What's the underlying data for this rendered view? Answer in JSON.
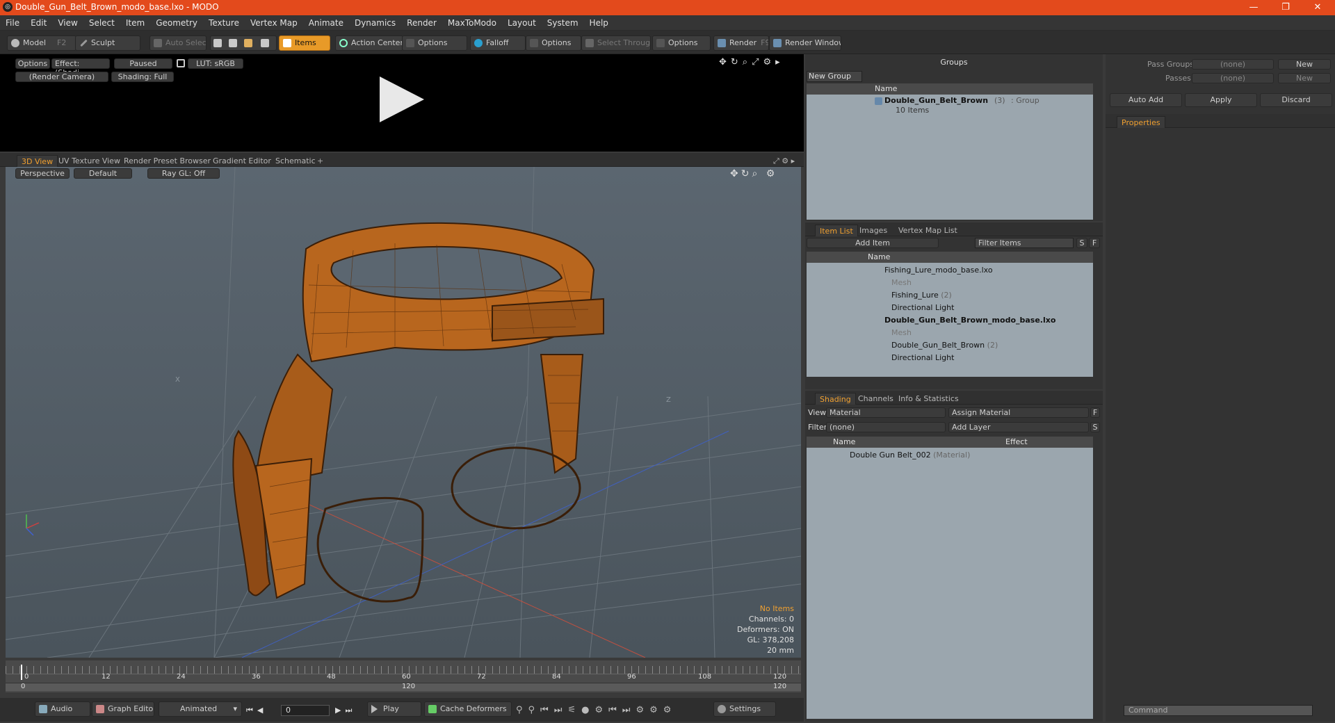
{
  "window": {
    "title": "Double_Gun_Belt_Brown_modo_base.lxo - MODO",
    "app_icon": "modo-icon"
  },
  "menu": [
    "File",
    "Edit",
    "View",
    "Select",
    "Item",
    "Geometry",
    "Texture",
    "Vertex Map",
    "Animate",
    "Dynamics",
    "Render",
    "MaxToModo",
    "Layout",
    "System",
    "Help"
  ],
  "toolbar": {
    "model": "Model",
    "model_key": "F2",
    "sculpt": "Sculpt",
    "auto_select": "Auto Select",
    "items": "Items",
    "action_center": "Action Center",
    "options1": "Options",
    "falloff": "Falloff",
    "options2": "Options",
    "select_through": "Select Through",
    "options3": "Options",
    "render": "Render",
    "render_key": "F9",
    "render_window": "Render Window"
  },
  "preview": {
    "options": "Options",
    "effect": "Effect: (Shadi...",
    "paused": "Paused",
    "lut": "LUT: sRGB",
    "camera": "(Render Camera)",
    "shading": "Shading: Full"
  },
  "viewport": {
    "tabs": [
      "3D View",
      "UV Texture View",
      "Render Preset Browser",
      "Gradient Editor",
      "Schematic"
    ],
    "perspective": "Perspective",
    "default": "Default",
    "raygl": "Ray GL: Off",
    "axis_labels": {
      "x": "X",
      "z": "Z"
    },
    "stats": {
      "title": "No Items",
      "channels": "Channels: 0",
      "deformers": "Deformers: ON",
      "gl": "GL: 378,208",
      "size": "20 mm"
    }
  },
  "timeline": {
    "ticks": [
      "0",
      "12",
      "24",
      "36",
      "48",
      "60",
      "72",
      "84",
      "96",
      "108",
      "120"
    ],
    "sub_left": "0",
    "sub_mid": "120",
    "sub_right": "120"
  },
  "bottombar": {
    "audio": "Audio",
    "graph_editor": "Graph Editor",
    "animated": "Animated",
    "frame": "0",
    "play": "Play",
    "cache": "Cache Deformers",
    "settings": "Settings"
  },
  "groups": {
    "title": "Groups",
    "new_group": "New Group",
    "col_name": "Name",
    "item_name": "Double_Gun_Belt_Brown",
    "item_count": "(3)",
    "item_type": ": Group",
    "item_sub": "10 Items"
  },
  "itemlist": {
    "tabs": [
      "Item List",
      "Images",
      "Vertex Map List"
    ],
    "add_item": "Add Item",
    "filter": "Filter Items",
    "s": "S",
    "f": "F",
    "col_name": "Name",
    "rows": [
      {
        "label": "Fishing_Lure_modo_base.lxo",
        "bold": false
      },
      {
        "label": "Mesh",
        "dim": true
      },
      {
        "label": "Fishing_Lure",
        "count": "(2)"
      },
      {
        "label": "Directional Light"
      },
      {
        "label": "Double_Gun_Belt_Brown_modo_base.lxo",
        "bold": true
      },
      {
        "label": "Mesh",
        "dim": true
      },
      {
        "label": "Double_Gun_Belt_Brown",
        "count": "(2)"
      },
      {
        "label": "Directional Light"
      }
    ]
  },
  "shading": {
    "tabs": [
      "Shading",
      "Channels",
      "Info & Statistics"
    ],
    "view_label": "View",
    "view_value": "Material",
    "assign": "Assign Material",
    "f": "F",
    "filter_label": "Filter",
    "filter_value": "(none)",
    "add_layer": "Add Layer",
    "s": "S",
    "col_name": "Name",
    "col_effect": "Effect",
    "row": "Double Gun Belt_002",
    "row_type": "(Material)"
  },
  "right": {
    "pass_groups": "Pass Groups",
    "passes": "Passes",
    "none1": "(none)",
    "none2": "(none)",
    "new1": "New",
    "new2": "New",
    "auto_add": "Auto Add",
    "apply": "Apply",
    "discard": "Discard",
    "properties": "Properties",
    "command": "Command"
  },
  "colors": {
    "accent": "#f0a030",
    "titlebar": "#e34a1c",
    "belt": "#b8661e"
  }
}
